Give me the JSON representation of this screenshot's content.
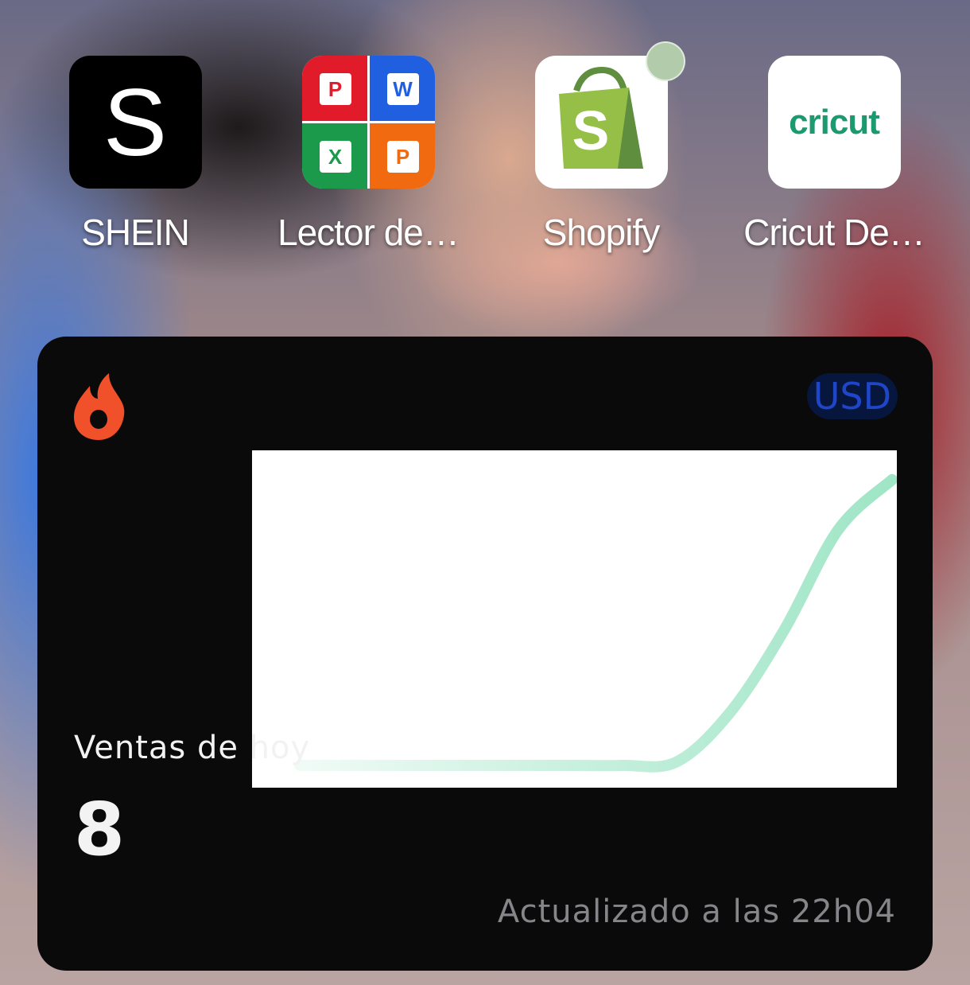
{
  "apps": [
    {
      "label": "SHEIN",
      "icon": "shein-icon"
    },
    {
      "label": "Lector de…",
      "icon": "office-reader-icon"
    },
    {
      "label": "Shopify",
      "icon": "shopify-bag-icon",
      "has_notification": true
    },
    {
      "label": "Cricut De…",
      "icon": "cricut-icon"
    }
  ],
  "shein_glyph": "S",
  "lector_glyphs": {
    "pdf": "P",
    "word": "W",
    "excel": "X",
    "ppt": "P"
  },
  "shopify_glyph": "S",
  "cricut_wordmark": "cricut",
  "widget": {
    "icon": "hotmart-flame-icon",
    "currency": "USD",
    "sales_label": "Ventas de hoy",
    "sales_value": "8",
    "updated_text": "Actualizado a las 22h04",
    "colors": {
      "background": "#0a0a0b",
      "accent": "#f0512a",
      "line": "#9fe5c6",
      "currency_text": "#1f46c8"
    }
  },
  "chart_data": {
    "type": "line",
    "series": [
      {
        "values": [
          0,
          0,
          0,
          0,
          0,
          0,
          0,
          0.1,
          1.5,
          3.8,
          6.6,
          8
        ]
      }
    ],
    "ylim": [
      0,
      8.6
    ],
    "grid": false,
    "legend": "none"
  }
}
